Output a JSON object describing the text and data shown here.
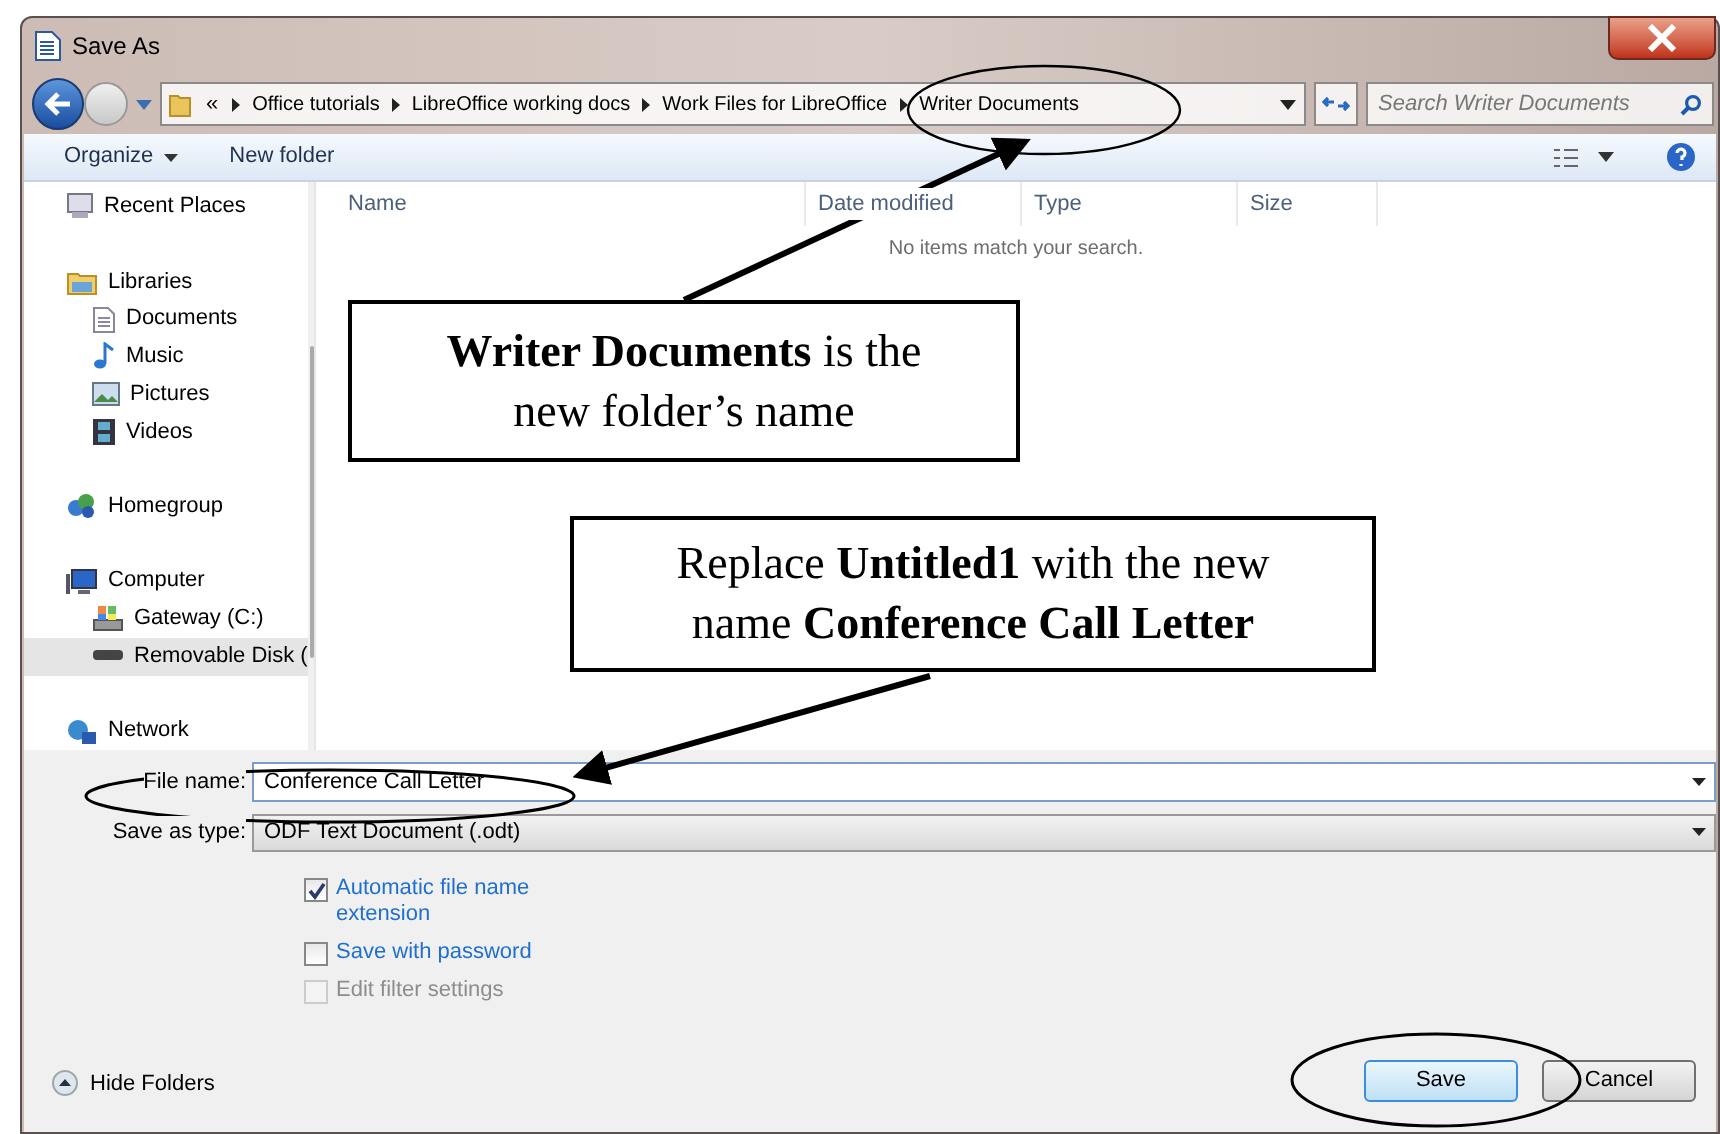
{
  "window": {
    "title": "Save As"
  },
  "address_bar": {
    "overflow": "«",
    "segments": [
      "Office tutorials",
      "LibreOffice working docs",
      "Work Files for LibreOffice",
      "Writer Documents"
    ]
  },
  "search": {
    "placeholder": "Search Writer Documents"
  },
  "toolbar": {
    "items": [
      {
        "label": "Organize",
        "kind": "menu"
      },
      {
        "label": "New folder",
        "kind": "plain"
      }
    ]
  },
  "navigation": [
    {
      "label": "Recent Places",
      "kind": "recent",
      "selected": false
    },
    {
      "label": "Libraries",
      "kind": "library",
      "selected": false,
      "children": [
        {
          "label": "Documents",
          "kind": "document",
          "selected": false
        },
        {
          "label": "Music",
          "kind": "music",
          "selected": false
        },
        {
          "label": "Pictures",
          "kind": "pictures",
          "selected": false
        },
        {
          "label": "Videos",
          "kind": "videos",
          "selected": false
        }
      ]
    },
    {
      "label": "Homegroup",
      "kind": "homegroup",
      "selected": false
    },
    {
      "label": "Computer",
      "kind": "computer",
      "selected": false,
      "children": [
        {
          "label": "Gateway (C:)",
          "kind": "drive",
          "selected": false
        },
        {
          "label": "Removable Disk (",
          "kind": "removable",
          "selected": true
        }
      ]
    },
    {
      "label": "Network",
      "kind": "network",
      "selected": false
    }
  ],
  "file_list": {
    "columns": [
      "Name",
      "Date modified",
      "Type",
      "Size"
    ],
    "empty_message": "No items match your search."
  },
  "file_name": {
    "label": "File name:",
    "value": "Conference Call Letter"
  },
  "save_as_type": {
    "label": "Save as type:",
    "value": "ODF Text Document (.odt)"
  },
  "options": [
    {
      "label": "Automatic file name extension",
      "checked": true,
      "disabled": false
    },
    {
      "label": "Save with password",
      "checked": false,
      "disabled": false
    },
    {
      "label": "Edit filter settings",
      "checked": false,
      "disabled": true
    }
  ],
  "hide_folders": "Hide Folders",
  "buttons": [
    {
      "label": "Save",
      "default": true
    },
    {
      "label": "Cancel",
      "default": false
    }
  ],
  "annotations": [
    {
      "text": "**Writer Documents** is the new folder’s name"
    },
    {
      "text": "Replace **Untitled1** with the new name **Conference Call Letter**"
    }
  ]
}
